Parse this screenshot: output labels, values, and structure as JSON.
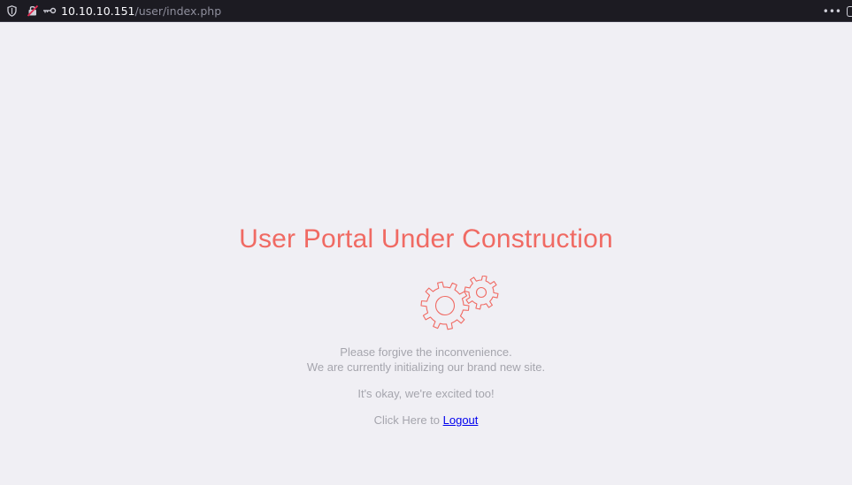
{
  "browser": {
    "url_host": "10.10.10.151",
    "url_path": "/user/index.php",
    "icons": [
      "shield-icon",
      "insecure-lock-icon",
      "key-icon",
      "more-icon"
    ]
  },
  "page": {
    "title": "User Portal Under Construction",
    "line1": "Please forgive the inconvenience.",
    "line2": "We are currently initializing our brand new site.",
    "line3": "It's okay, we're excited too!",
    "logout_prefix": "Click Here to ",
    "logout_label": "Logout"
  },
  "colors": {
    "accent": "#f06a63",
    "text_muted": "#a5a5ad",
    "link": "#0000ee",
    "background": "#f0eff4",
    "toolbar": "#1c1b22"
  }
}
